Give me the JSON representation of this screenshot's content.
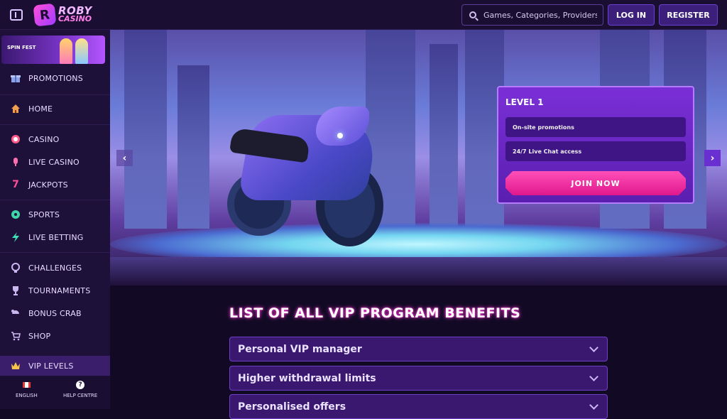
{
  "header": {
    "logo_line1": "ROBY",
    "logo_line2": "CASINO",
    "logo_badge": "R",
    "search_placeholder": "Games, Categories, Providers",
    "login_label": "LOG IN",
    "register_label": "REGISTER"
  },
  "sidebar": {
    "banner_label": "SPIN FEST",
    "items": [
      {
        "label": "PROMOTIONS",
        "icon": "gift-icon"
      },
      {
        "label": "HOME",
        "icon": "home-icon"
      },
      {
        "label": "CASINO",
        "icon": "casino-chip-icon"
      },
      {
        "label": "LIVE CASINO",
        "icon": "live-casino-icon"
      },
      {
        "label": "JACKPOTS",
        "icon": "seven-icon"
      },
      {
        "label": "SPORTS",
        "icon": "ball-icon"
      },
      {
        "label": "LIVE BETTING",
        "icon": "lightning-icon"
      },
      {
        "label": "CHALLENGES",
        "icon": "medal-icon"
      },
      {
        "label": "TOURNAMENTS",
        "icon": "trophy-icon"
      },
      {
        "label": "BONUS CRAB",
        "icon": "crab-icon"
      },
      {
        "label": "SHOP",
        "icon": "cart-icon"
      },
      {
        "label": "VIP LEVELS",
        "icon": "crown-icon"
      }
    ],
    "language_label": "ENGLISH",
    "help_label": "HELP CENTRE",
    "help_glyph": "?"
  },
  "hero": {
    "prev_glyph": "‹",
    "next_glyph": "›"
  },
  "level_card": {
    "title": "LEVEL 1",
    "benefits": [
      "On-site promotions",
      "24/7 Live Chat access"
    ],
    "join_label": "JOIN NOW"
  },
  "vip": {
    "title": "LIST OF ALL VIP PROGRAM BENEFITS",
    "accordion": [
      "Personal VIP manager",
      "Higher withdrawal limits",
      "Personalised offers"
    ]
  },
  "colors": {
    "accent": "#6a2fd1",
    "join": "#ff4fb8",
    "background": "#120a24",
    "sidebar": "#1e1139"
  }
}
